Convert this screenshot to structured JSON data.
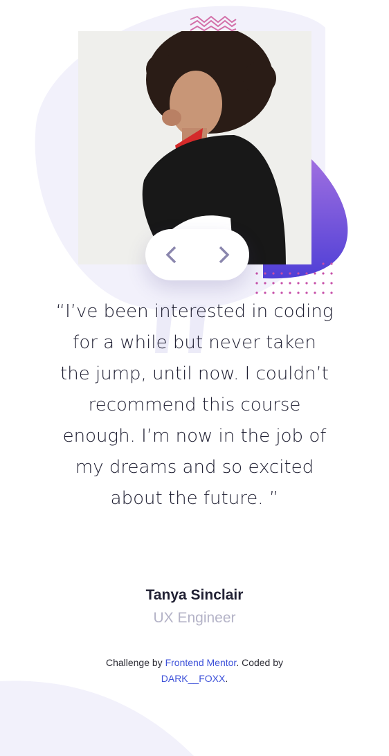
{
  "testimonial": {
    "quote": "“I’ve been interested in coding for a while but never taken the jump, until now. I couldn’t recommend this course enough. I’m now in the job of my dreams and so excited about the future. ”",
    "author_name": "Tanya Sinclair",
    "author_role": "UX Engineer"
  },
  "photo": {
    "subject": "Tanya Sinclair portrait"
  },
  "navigation": {
    "prev_icon": "chevron-left-icon",
    "next_icon": "chevron-right-icon"
  },
  "attribution": {
    "prefix": "Challenge by ",
    "link1": "Frontend Mentor",
    "middle": ". Coded by",
    "link2": "DARK__FOXX",
    "suffix": "."
  },
  "colors": {
    "accent_purple": "#7a5cd6",
    "accent_pink": "#c64fa8",
    "text_dark": "#202033",
    "text_muted": "#b4b3c7",
    "link": "#3e52d9"
  }
}
